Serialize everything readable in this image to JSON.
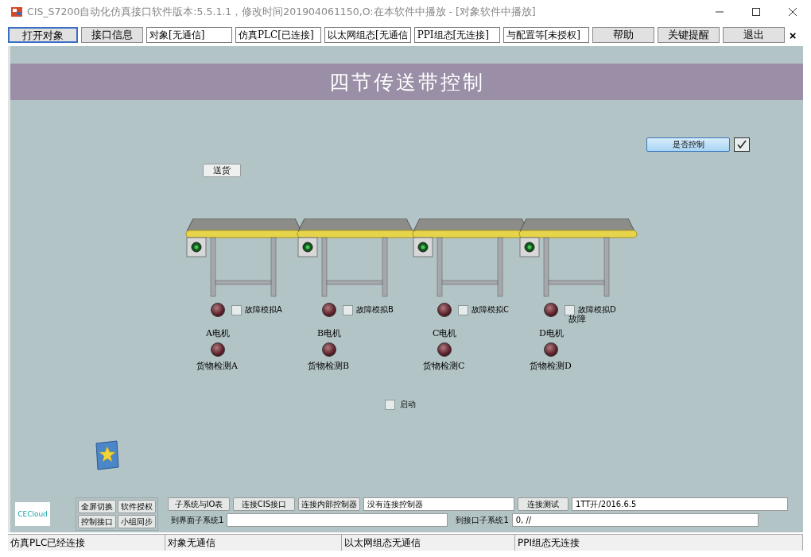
{
  "window": {
    "title": "CIS_S7200自动化仿真接口软件版本:5.5.1.1，修改时间201904061150,O:在本软件中播放 - [对象软件中播放]"
  },
  "toolbar": [
    {
      "kind": "button",
      "label": "打开对象"
    },
    {
      "kind": "button",
      "label": "接口信息"
    },
    {
      "kind": "field",
      "value": "对象[无通信]"
    },
    {
      "kind": "field",
      "value": "仿真PLC[已连接]"
    },
    {
      "kind": "field",
      "value": "以太网组态[无通信"
    },
    {
      "kind": "field",
      "value": "PPI组态[无连接]"
    },
    {
      "kind": "field",
      "value": "与配置等[未授权]"
    },
    {
      "kind": "button",
      "label": "帮助"
    },
    {
      "kind": "button",
      "label": "关键提醒"
    },
    {
      "kind": "button",
      "label": "退出"
    },
    {
      "kind": "close",
      "label": "×"
    }
  ],
  "panel": {
    "title": "四节传送带控制",
    "control_toggle": {
      "label": "是否控制",
      "checked": true
    },
    "deliver_button": "送货",
    "units": [
      {
        "motor_label": "A电机",
        "fault": {
          "label": "故障模拟A",
          "checked": false
        },
        "detect_label": "货物检测A"
      },
      {
        "motor_label": "B电机",
        "fault": {
          "label": "故障模拟B",
          "checked": false
        },
        "detect_label": "货物检测B"
      },
      {
        "motor_label": "C电机",
        "fault": {
          "label": "故障模拟C",
          "checked": false
        },
        "detect_label": "货物检测C"
      },
      {
        "motor_label": "D电机",
        "fault": {
          "label": "故障模拟D",
          "checked": false
        },
        "detect_label": "货物检测D",
        "note": "故障"
      }
    ],
    "start": {
      "label": "启动",
      "checked": false
    }
  },
  "bottom": {
    "logo": "CECloud",
    "group_buttons": [
      "全屏切换",
      "软件授权",
      "控制接口",
      "小组同步"
    ],
    "buttons": [
      "子系统与IO表",
      "连接CIS接口",
      "连接内部控制器"
    ],
    "status_field": "没有连接控制器",
    "test_button": "连接测试",
    "test_field": "1TT开/2016.6.5",
    "ui_label": "到界面子系统1",
    "io_label": "到接口子系统1",
    "io_field": "0, //"
  },
  "status_bar": [
    "仿真PLC已经连接",
    "对象无通信",
    "以太网组态无通信",
    "PPI组态无连接"
  ]
}
